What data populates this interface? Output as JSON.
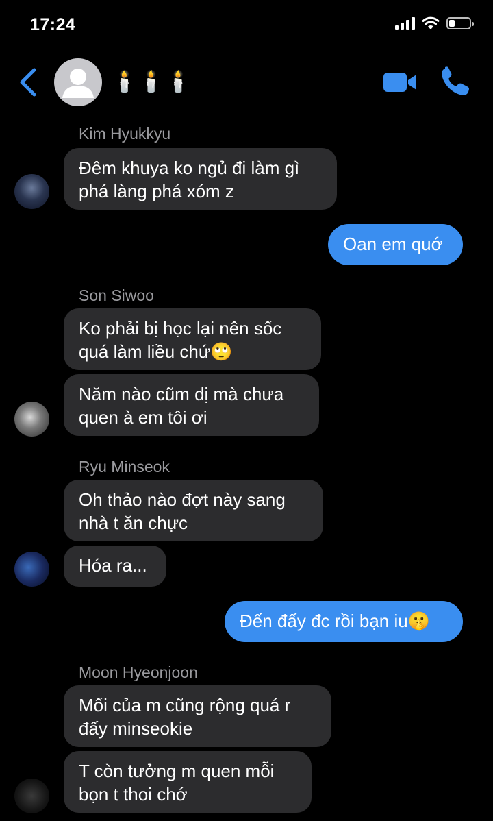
{
  "status_bar": {
    "time": "17:24"
  },
  "header": {
    "title": "🕯️🕯️🕯️"
  },
  "messages": {
    "s1_sender": "Kim Hyukkyu",
    "m1_line1": "Đêm khuya ko ngủ đi làm gì",
    "m1_line2": "phá làng phá xóm z",
    "m2": "Oan em quớ",
    "s2_sender": "Son Siwoo",
    "m3_line1": "Ko phải bị học lại nên sốc",
    "m3_line2": "quá làm liều chứ🙄",
    "m4_line1": "Năm nào cũm dị mà chưa",
    "m4_line2": "quen à em tôi ơi",
    "s3_sender": "Ryu Minseok",
    "m5_line1": "Oh thảo nào đợt này sang",
    "m5_line2": "nhà t ăn chực",
    "m6": "Hóa ra...",
    "m7": "Đến đấy đc rồi bạn iu🤫",
    "s4_sender": "Moon Hyeonjoon",
    "m8_line1": "Mối của m cũng rộng quá r",
    "m8_line2": "đấy minseokie",
    "m9_line1": "T còn tưởng m quen mỗi",
    "m9_line2": "bọn t thoi chớ"
  },
  "colors": {
    "accent": "#3a8ef0",
    "incoming_bubble": "#2c2c2e",
    "background": "#000000",
    "sender_name": "#9a9a9e"
  },
  "icons": {
    "back": "chevron-left-icon",
    "video": "video-camera-icon",
    "call": "phone-icon",
    "signal": "signal-icon",
    "wifi": "wifi-icon",
    "battery": "battery-icon"
  },
  "battery_level": 0.3
}
